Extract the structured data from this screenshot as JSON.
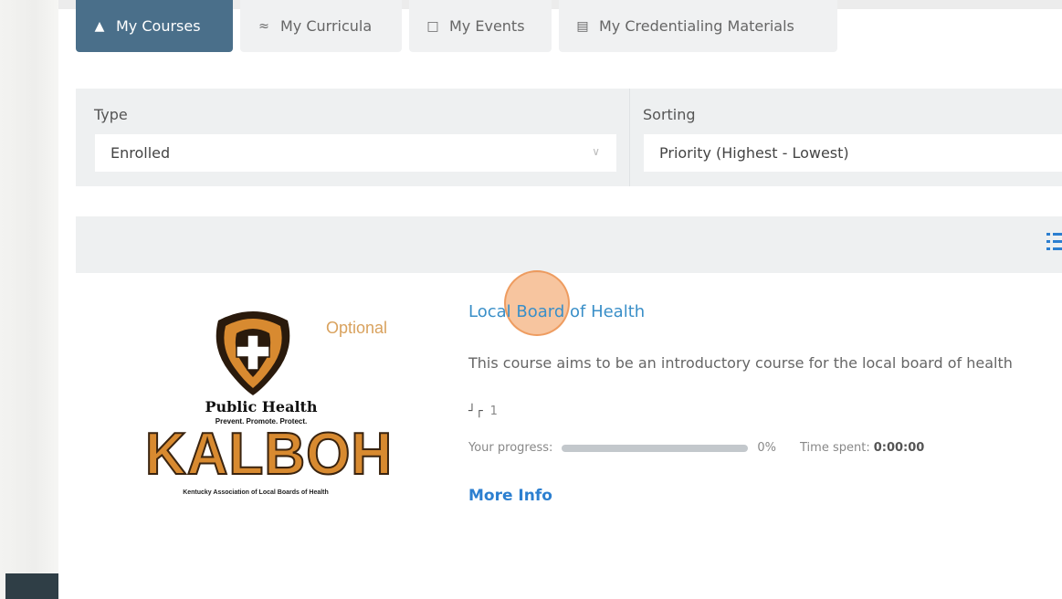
{
  "tabs": [
    {
      "label": "My Courses",
      "icon": "graduation-icon",
      "active": true
    },
    {
      "label": "My Curricula",
      "icon": "curricula-icon",
      "active": false
    },
    {
      "label": "My Events",
      "icon": "calendar-icon",
      "active": false
    },
    {
      "label": "My Credentialing Materials",
      "icon": "document-icon",
      "active": false
    }
  ],
  "filters": {
    "type_label": "Type",
    "type_value": "Enrolled",
    "sorting_label": "Sorting",
    "sorting_value": "Priority (Highest - Lowest)"
  },
  "course": {
    "logo": {
      "line1": "Public Health",
      "tagline": "Prevent.  Promote.  Protect.",
      "acronym": "KALBOH",
      "full_name": "Kentucky Association of Local Boards of Health"
    },
    "badge": "Optional",
    "title": "Local Board of Health",
    "description": "This course aims to be an introductory course for the local board of health",
    "steps": "1",
    "progress_label": "Your progress:",
    "progress_percent": 0,
    "progress_text": "0%",
    "time_spent_label": "Time spent:",
    "time_spent_value": "0:00:00",
    "more_info": "More Info"
  },
  "colors": {
    "accent": "#4a6f8a",
    "link": "#3a8fc8",
    "optional": "#d9a25e",
    "kalboh_orange": "#d88a30"
  }
}
